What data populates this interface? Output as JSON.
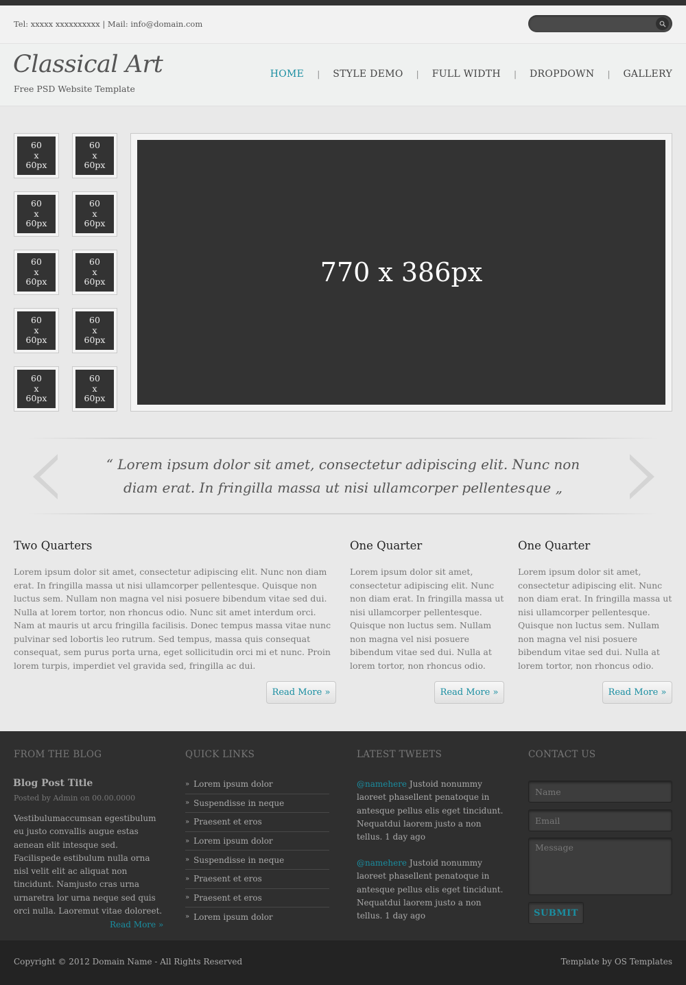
{
  "topbar": {
    "contact": "Tel: xxxxx xxxxxxxxxx | Mail: info@domain.com",
    "search_placeholder": "",
    "search_icon": "search-icon"
  },
  "header": {
    "title": "Classical Art",
    "tagline": "Free PSD Website Template",
    "nav": [
      "HOME",
      "STYLE DEMO",
      "FULL WIDTH",
      "DROPDOWN",
      "GALLERY"
    ],
    "active_nav": "HOME"
  },
  "gallery": {
    "thumb_label": "60\nx\n60px",
    "main_label": "770 x 386px"
  },
  "quote": {
    "text": "“ Lorem ipsum dolor sit amet, consectetur adipiscing elit. Nunc non diam erat. In fringilla massa ut nisi ullamcorper pellentesque „",
    "prev_icon": "chevron-left-icon",
    "next_icon": "chevron-right-icon"
  },
  "columns": [
    {
      "title": "Two Quarters",
      "text": "Lorem ipsum dolor sit amet, consectetur adipiscing elit. Nunc non diam erat. In fringilla massa ut nisi ullamcorper pellentesque. Quisque non luctus sem. Nullam non magna vel nisi posuere bibendum vitae sed dui. Nulla at lorem tortor, non rhoncus odio. Nunc sit amet interdum orci. Nam at mauris ut arcu fringilla facilisis. Donec tempus massa vitae nunc pulvinar sed lobortis leo rutrum. Sed tempus, massa quis consequat consequat, sem purus porta urna, eget sollicitudin orci mi et nunc. Proin lorem turpis, imperdiet vel gravida sed, fringilla ac dui.",
      "button": "Read More »"
    },
    {
      "title": "One Quarter",
      "text": "Lorem ipsum dolor sit amet, consectetur adipiscing elit. Nunc non diam erat. In fringilla massa ut nisi ullamcorper pellentesque. Quisque non luctus sem. Nullam non magna vel nisi posuere bibendum vitae sed dui. Nulla at lorem tortor, non rhoncus odio.",
      "button": "Read More »"
    },
    {
      "title": "One Quarter",
      "text": "Lorem ipsum dolor sit amet, consectetur adipiscing elit. Nunc non diam erat. In fringilla massa ut nisi ullamcorper pellentesque. Quisque non luctus sem. Nullam non magna vel nisi posuere bibendum vitae sed dui. Nulla at lorem tortor, non rhoncus odio.",
      "button": "Read More »"
    }
  ],
  "footer": {
    "blog": {
      "heading": "FROM THE BLOG",
      "post_title": "Blog Post Title",
      "meta": "Posted by Admin on 00.00.0000",
      "text": "Vestibulumaccumsan egestibulum eu justo convallis augue estas aenean elit intesque sed. Facilispede estibulum nulla orna nisl velit elit ac aliquat non tincidunt. Namjusto cras urna urnaretra lor urna neque sed quis orci nulla. Laoremut vitae doloreet.",
      "more": "Read More »"
    },
    "quick_links": {
      "heading": "QUICK LINKS",
      "items": [
        "Lorem ipsum dolor",
        "Suspendisse in neque",
        "Praesent et eros",
        "Lorem ipsum dolor",
        "Suspendisse in neque",
        "Praesent et eros",
        "Praesent et eros",
        "Lorem ipsum dolor"
      ]
    },
    "tweets": {
      "heading": "LATEST TWEETS",
      "items": [
        {
          "handle": "@namehere",
          "text": " Justoid nonummy laoreet phasellent penatoque in antesque pellus elis eget tincidunt. Nequatdui laorem justo a non tellus.  1 day ago"
        },
        {
          "handle": "@namehere",
          "text": " Justoid nonummy laoreet phasellent penatoque in antesque pellus elis eget tincidunt. Nequatdui laorem justo a non tellus. 1 day ago"
        }
      ]
    },
    "contact": {
      "heading": "CONTACT US",
      "name_placeholder": "Name",
      "email_placeholder": "Email",
      "message_placeholder": "Message",
      "submit": "SUBMIT"
    }
  },
  "bottom": {
    "copyright": "Copyright © 2012 Domain Name - All Rights Reserved",
    "credit": "Template by OS Templates"
  },
  "colors": {
    "accent": "#1a8ea1",
    "dark_panel": "#333333",
    "footer": "#2f2f2f",
    "bottom_bar": "#232323"
  }
}
